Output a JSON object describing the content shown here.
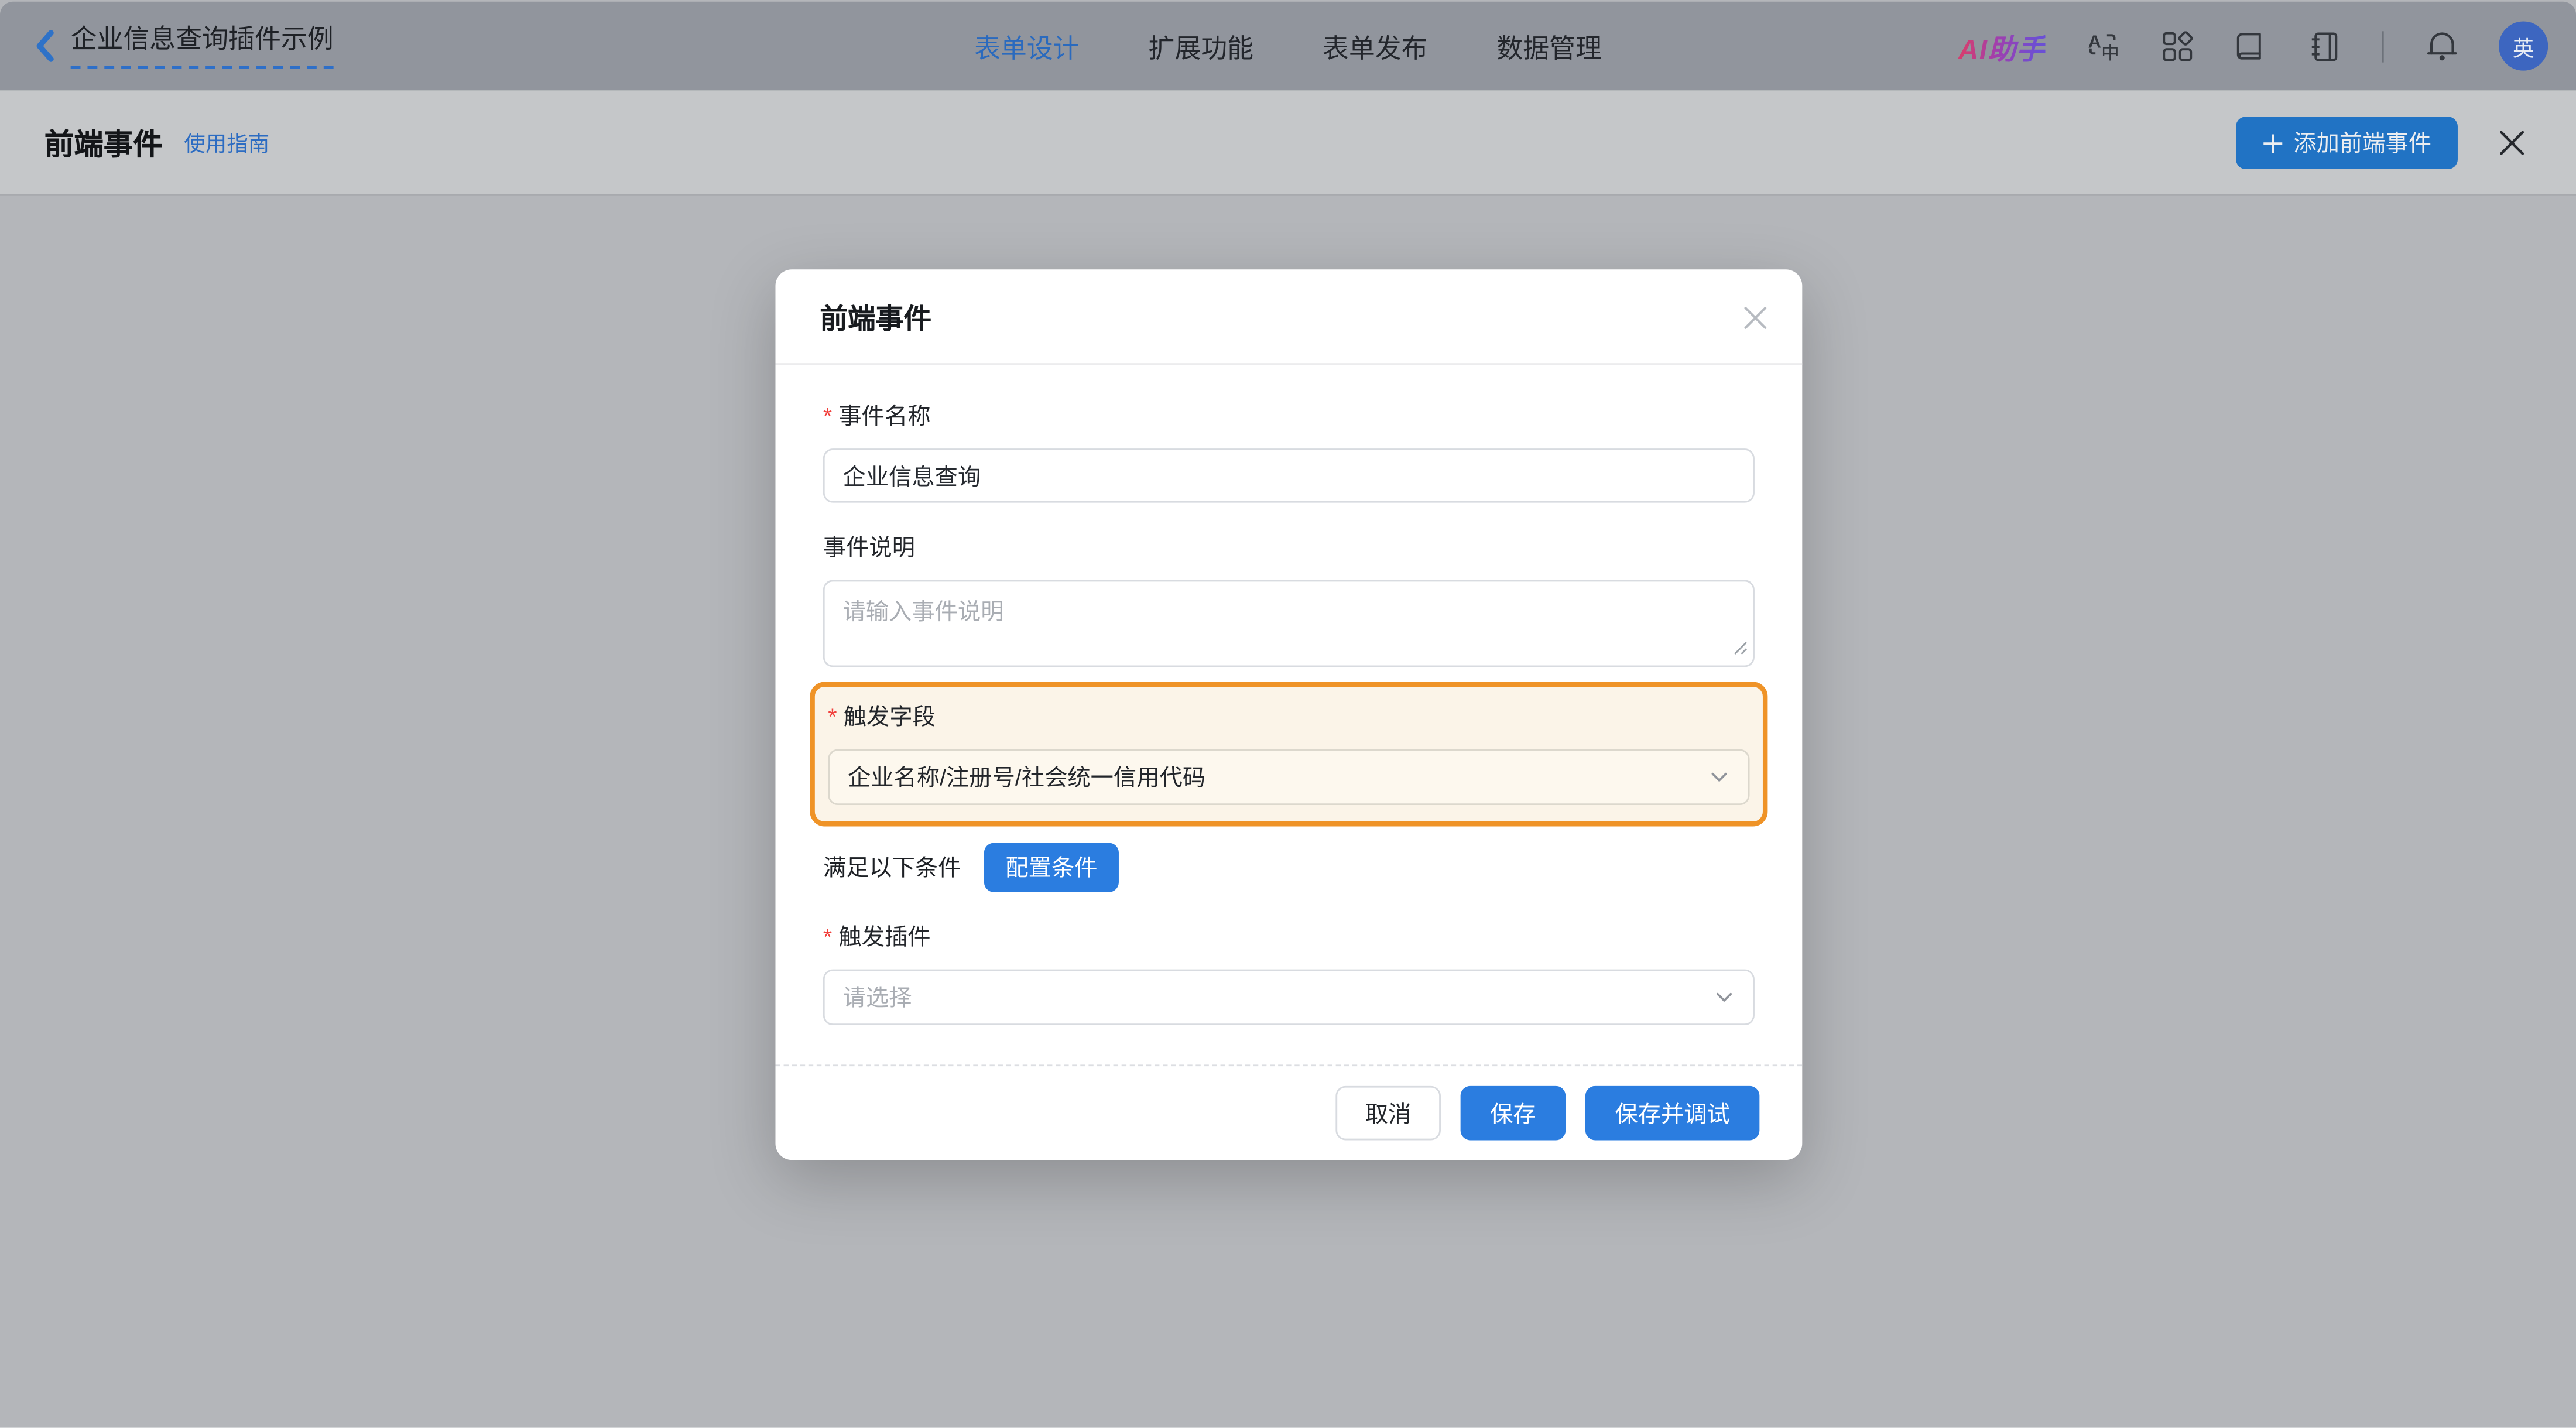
{
  "topbar": {
    "back_title": "企业信息查询插件示例",
    "tabs": [
      {
        "label": "表单设计",
        "active": true
      },
      {
        "label": "扩展功能",
        "active": false
      },
      {
        "label": "表单发布",
        "active": false
      },
      {
        "label": "数据管理",
        "active": false
      }
    ],
    "ai_logo": "AI助手",
    "avatar_text": "英"
  },
  "toolbar": {
    "title": "前端事件",
    "guide_link": "使用指南",
    "add_button_label": "添加前端事件"
  },
  "modal": {
    "title": "前端事件",
    "required_mark": "*",
    "event_name": {
      "label": "事件名称",
      "value": "企业信息查询"
    },
    "event_desc": {
      "label": "事件说明",
      "placeholder": "请输入事件说明"
    },
    "trigger_field": {
      "label": "触发字段",
      "value": "企业名称/注册号/社会统一信用代码"
    },
    "condition": {
      "text": "满足以下条件",
      "button_label": "配置条件"
    },
    "trigger_plugin": {
      "label": "触发插件",
      "placeholder": "请选择"
    },
    "footer": {
      "cancel": "取消",
      "save": "保存",
      "save_debug": "保存并调试"
    }
  },
  "colors": {
    "accent_blue": "#2b7de0",
    "dimmed_button_blue": "#2173c4",
    "orange_highlight": "#ef9327",
    "highlight_bg": "#fbf4e8",
    "topbar_bg": "#91959d",
    "subheader_bg": "#c5c7c9",
    "body_bg": "#b4b6ba",
    "avatar_bg": "#3d66c0"
  }
}
